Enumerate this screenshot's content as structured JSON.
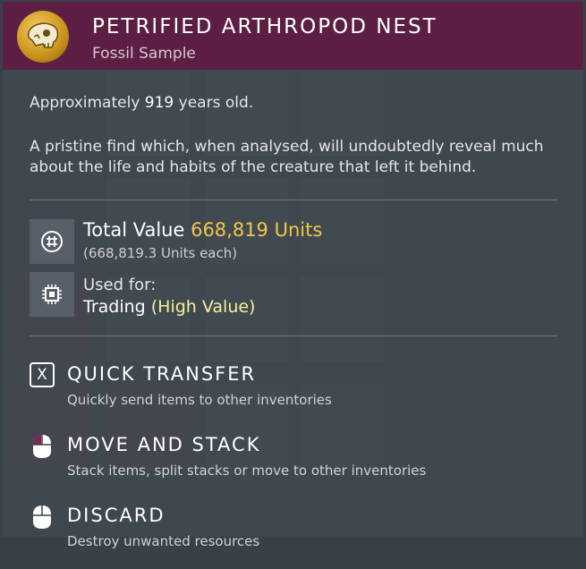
{
  "item": {
    "title": "PETRIFIED ARTHROPOD NEST",
    "subtitle": "Fossil Sample",
    "icon": "fossil-skull-icon"
  },
  "age": {
    "prefix": "Approximately ",
    "value": "919",
    "suffix": " years old."
  },
  "description": "A pristine find which, when analysed, will undoubtedly reveal much about the life and habits of the creature that left it behind.",
  "value": {
    "label": "Total Value ",
    "amount": "668,819 Units",
    "each": "(668,819.3 Units each)",
    "icon": "units-currency-icon"
  },
  "usage": {
    "label": "Used for:",
    "category": "Trading",
    "qualifier": "(High Value)",
    "icon": "chip-icon"
  },
  "actions": [
    {
      "title": "QUICK TRANSFER",
      "desc": "Quickly send items to other inventories",
      "icon": "x-key-icon",
      "key": "X"
    },
    {
      "title": "MOVE AND STACK",
      "desc": "Stack items, split stacks or move to other inventories",
      "icon": "mouse-left-click-icon"
    },
    {
      "title": "DISCARD",
      "desc": "Destroy unwanted resources",
      "icon": "mouse-right-click-icon"
    }
  ],
  "colors": {
    "header_bg": "#5c1f43",
    "value_amount": "#f2c64a",
    "high_value": "#f7ef9c"
  }
}
